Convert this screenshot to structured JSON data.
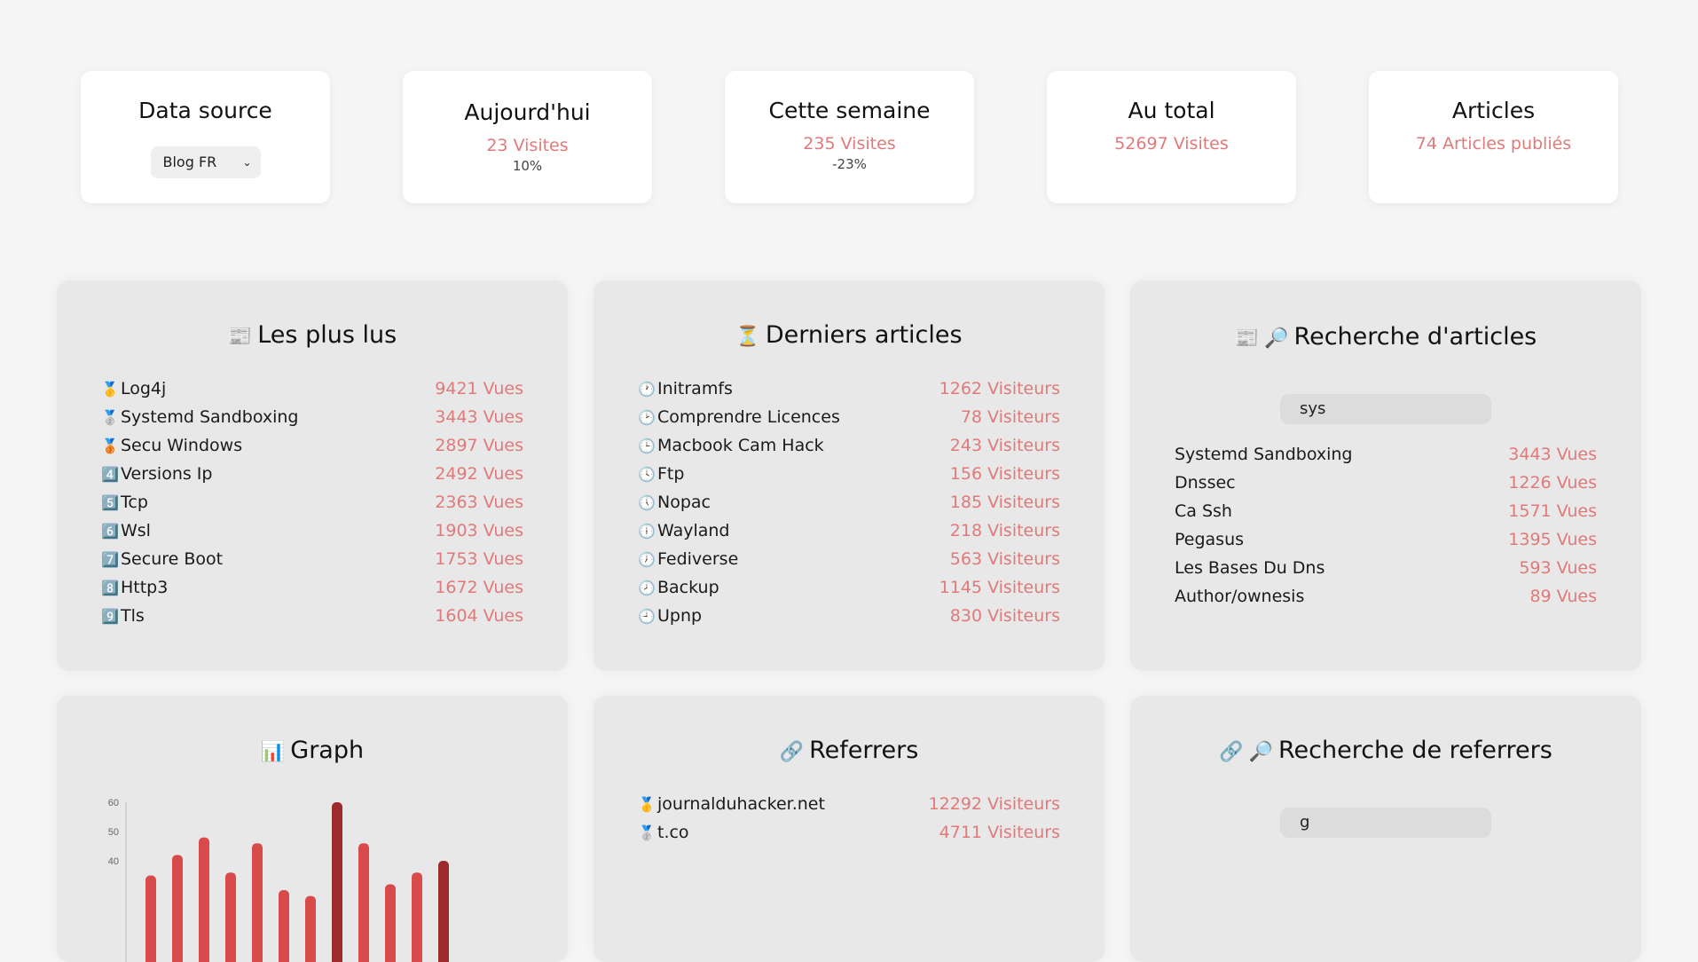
{
  "stats": {
    "source": {
      "title": "Data source",
      "selected": "Blog FR"
    },
    "today": {
      "title": "Aujourd'hui",
      "value": "23 Visites",
      "sub": "10%"
    },
    "week": {
      "title": "Cette semaine",
      "value": "235 Visites",
      "sub": "-23%"
    },
    "total": {
      "title": "Au total",
      "value": "52697 Visites"
    },
    "articles": {
      "title": "Articles",
      "value": "74 Articles publiés"
    }
  },
  "popular": {
    "title": "Les plus lus",
    "icon": "newspaper-icon",
    "items": [
      {
        "icon": "🥇",
        "label": "Log4j",
        "value": "9421 Vues"
      },
      {
        "icon": "🥈",
        "label": "Systemd Sandboxing",
        "value": "3443 Vues"
      },
      {
        "icon": "🥉",
        "label": "Secu Windows",
        "value": "2897 Vues"
      },
      {
        "icon": "4️⃣",
        "label": "Versions Ip",
        "value": "2492 Vues"
      },
      {
        "icon": "5️⃣",
        "label": "Tcp",
        "value": "2363 Vues"
      },
      {
        "icon": "6️⃣",
        "label": "Wsl",
        "value": "1903 Vues"
      },
      {
        "icon": "7️⃣",
        "label": "Secure Boot",
        "value": "1753 Vues"
      },
      {
        "icon": "8️⃣",
        "label": "Http3",
        "value": "1672 Vues"
      },
      {
        "icon": "9️⃣",
        "label": "Tls",
        "value": "1604 Vues"
      }
    ]
  },
  "latest": {
    "title": "Derniers articles",
    "icon": "hourglass-icon",
    "items": [
      {
        "icon": "🕐",
        "label": "Initramfs",
        "value": "1262 Visiteurs"
      },
      {
        "icon": "🕑",
        "label": "Comprendre Licences",
        "value": "78 Visiteurs"
      },
      {
        "icon": "🕒",
        "label": "Macbook Cam Hack",
        "value": "243 Visiteurs"
      },
      {
        "icon": "🕓",
        "label": "Ftp",
        "value": "156 Visiteurs"
      },
      {
        "icon": "🕔",
        "label": "Nopac",
        "value": "185 Visiteurs"
      },
      {
        "icon": "🕕",
        "label": "Wayland",
        "value": "218 Visiteurs"
      },
      {
        "icon": "🕖",
        "label": "Fediverse",
        "value": "563 Visiteurs"
      },
      {
        "icon": "🕗",
        "label": "Backup",
        "value": "1145 Visiteurs"
      },
      {
        "icon": "🕘",
        "label": "Upnp",
        "value": "830 Visiteurs"
      }
    ]
  },
  "search_articles": {
    "title": "Recherche d'articles",
    "query": "sys",
    "items": [
      {
        "label": "Systemd Sandboxing",
        "value": "3443 Vues"
      },
      {
        "label": "Dnssec",
        "value": "1226 Vues"
      },
      {
        "label": "Ca Ssh",
        "value": "1571 Vues"
      },
      {
        "label": "Pegasus",
        "value": "1395 Vues"
      },
      {
        "label": "Les Bases Du Dns",
        "value": "593 Vues"
      },
      {
        "label": "Author/ownesis",
        "value": "89 Vues"
      }
    ]
  },
  "graph": {
    "title": "Graph",
    "icon": "bar-chart-icon"
  },
  "referrers": {
    "title": "Referrers",
    "icon": "link-icon",
    "items": [
      {
        "icon": "🥇",
        "label": "journalduhacker.net",
        "value": "12292 Visiteurs"
      },
      {
        "icon": "🥈",
        "label": "t.co",
        "value": "4711 Visiteurs"
      }
    ]
  },
  "search_referrers": {
    "title": "Recherche de referrers",
    "query": "g"
  },
  "chart_data": {
    "type": "bar",
    "yticks": [
      60,
      50,
      40
    ],
    "ylim": [
      0,
      60
    ],
    "values": [
      35,
      42,
      48,
      36,
      46,
      30,
      28,
      60,
      46,
      32,
      36,
      40
    ],
    "colors": [
      "#d94b4b",
      "#d94b4b",
      "#d94b4b",
      "#d94b4b",
      "#d94b4b",
      "#d94b4b",
      "#d94b4b",
      "#9e2b2b",
      "#d94b4b",
      "#d94b4b",
      "#d94b4b",
      "#9e2b2b"
    ]
  }
}
